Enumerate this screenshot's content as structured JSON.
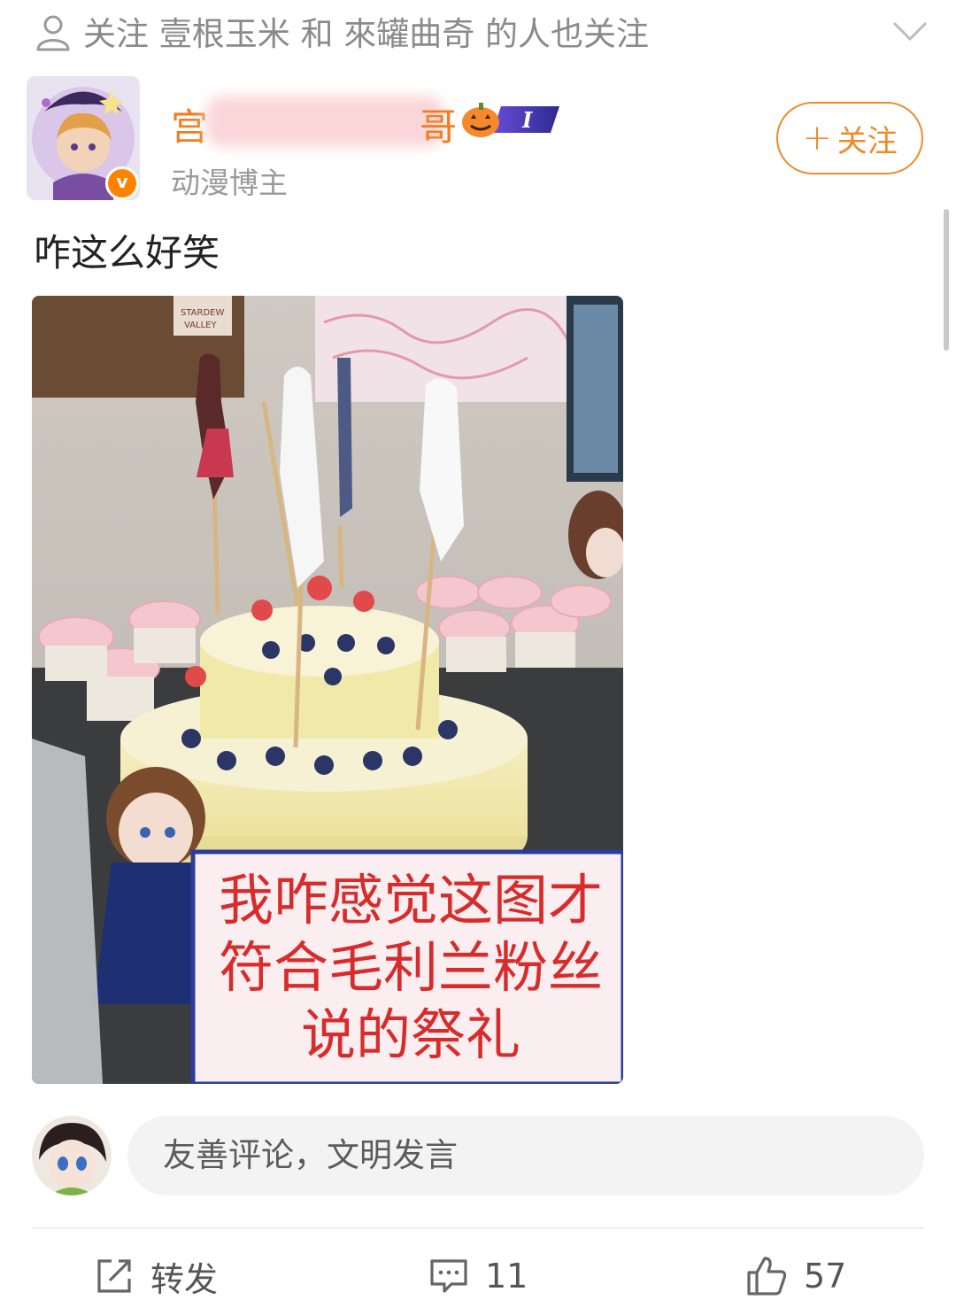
{
  "recommend": {
    "prefix": "关注",
    "users_text": "壹根玉米 和 來罐曲奇 的人也关注"
  },
  "author": {
    "name_visible_start": "宫",
    "name_visible_end": "哥",
    "title": "动漫博主",
    "verified_mark": "v"
  },
  "follow_button": {
    "plus": "+",
    "label": "关注"
  },
  "post": {
    "text": "咋这么好笑",
    "image_caption_lines": [
      "我咋感觉这图才",
      "符合毛利兰粉丝",
      "说的祭礼"
    ],
    "image_sign_text": "STARDEW VALLEY"
  },
  "comment_box": {
    "placeholder": "友善评论，文明发言"
  },
  "actions": {
    "repost_label": "转发",
    "comment_count": "11",
    "like_count": "57"
  },
  "colors": {
    "accent": "#f77a1c",
    "caption_red": "#d72c2c",
    "caption_border": "#2b3c9a"
  }
}
